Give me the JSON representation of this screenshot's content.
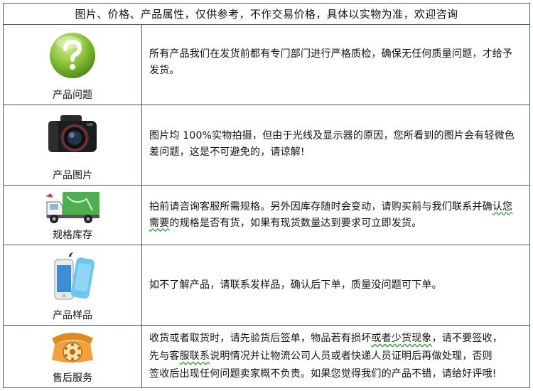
{
  "header": {
    "notice": "图片、价格、产品属性，仅供参考，不作交易价格，具体以实物为准，欢迎咨询"
  },
  "rows": [
    {
      "caption": "产品问题",
      "icon": "question-icon",
      "text": "所有产品我们在发货前都有专门部门进行严格质检，确保无任何质量问题，才给予发货。"
    },
    {
      "caption": "产品图片",
      "icon": "camera-icon",
      "text": "图片均 100%实物拍摄，但由于光线及显示器的原因，您所看到的图片会有轻微色差问题，这是不可避免的，请谅解!"
    },
    {
      "caption": "规格库存",
      "icon": "delivery-truck-icon",
      "text_a": "拍前请咨询客服所需规格。另外因库存随时会变动，请购买前与我们联系并确",
      "text_b_mark": "认您需要",
      "text_b_rest": "的规格是否有货，如果有现货数量达到要求可立即发货。"
    },
    {
      "caption": "产品样品",
      "icon": "smartphone-icon",
      "text": "如不了解产品，请联系发样品，确认后下单，质量没问题可下单。"
    },
    {
      "caption": "售后服务",
      "icon": "telephone-icon",
      "line1_a": "收货或者取货时，请先验货后签单，物品若有损坏",
      "line1_mark": "或者少货现象",
      "line1_b": "，请不要签收，",
      "line2_a": "先与客",
      "line2_mark": "服联系",
      "line2_b": "说明情况并让物流公司人员或者快递人员证明后再做处理，否则",
      "line3": "签收后出现任何问题卖家概不负责。如果您觉得我们的产品不错，请给好评哦!"
    }
  ],
  "colors": {
    "border": "#4d5a68",
    "question_green": "#8cc43a",
    "truck_green": "#4cb04f",
    "phone_orange": "#f2a13a"
  }
}
